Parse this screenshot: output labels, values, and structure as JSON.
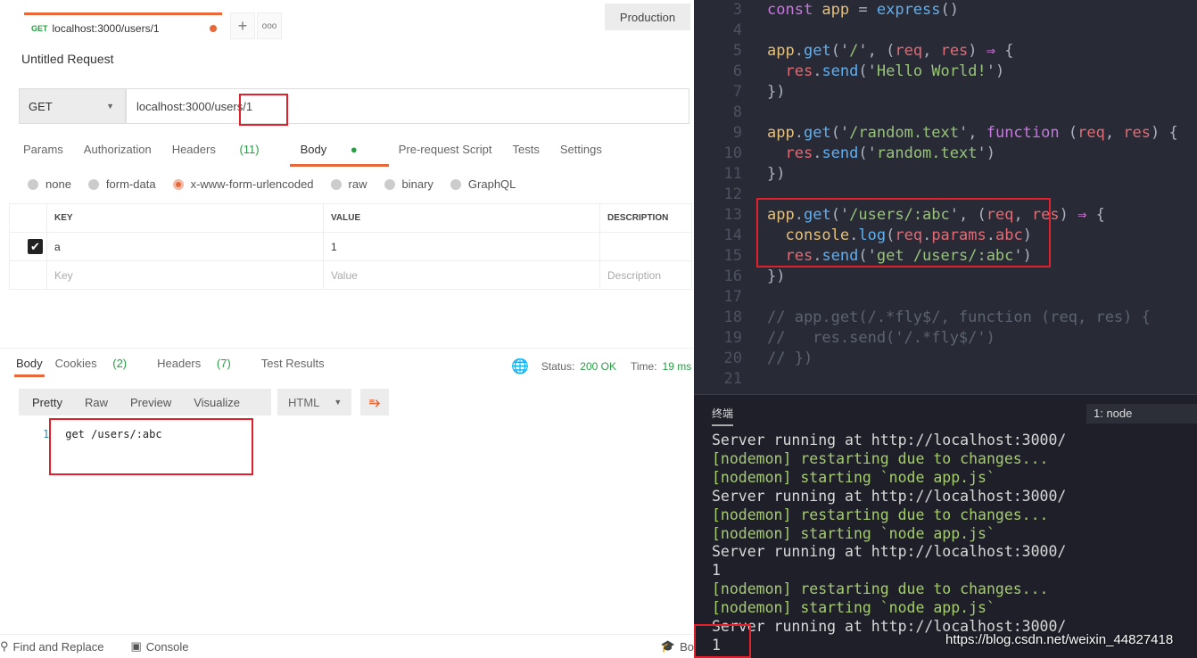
{
  "postman": {
    "tab": {
      "method": "GET",
      "url": "localhost:3000/users/1"
    },
    "environment": "Production",
    "request_title": "Untitled Request",
    "method": "GET",
    "url": "localhost:3000/users/1",
    "request_tabs": [
      {
        "label": "Params"
      },
      {
        "label": "Authorization"
      },
      {
        "label": "Headers",
        "count": "(11)"
      },
      {
        "label": "Body",
        "active": true
      },
      {
        "label": "Pre-request Script"
      },
      {
        "label": "Tests"
      },
      {
        "label": "Settings"
      }
    ],
    "body_types": [
      "none",
      "form-data",
      "x-www-form-urlencoded",
      "raw",
      "binary",
      "GraphQL"
    ],
    "body_type_selected": "x-www-form-urlencoded",
    "table": {
      "headers": [
        "KEY",
        "VALUE",
        "DESCRIPTION"
      ],
      "rows": [
        {
          "checked": true,
          "key": "a",
          "value": "1",
          "description": ""
        }
      ],
      "placeholders": {
        "key": "Key",
        "value": "Value",
        "description": "Description"
      }
    },
    "response_tabs": [
      {
        "label": "Body"
      },
      {
        "label": "Cookies",
        "count": "(2)"
      },
      {
        "label": "Headers",
        "count": "(7)"
      },
      {
        "label": "Test Results"
      }
    ],
    "status_label": "Status:",
    "status": "200 OK",
    "time_label": "Time:",
    "time": "19 ms",
    "view_modes": [
      "Pretty",
      "Raw",
      "Preview",
      "Visualize"
    ],
    "format": "HTML",
    "response_body": {
      "line": "1",
      "text": "get /users/:abc"
    },
    "footer": {
      "find": "Find and Replace",
      "console": "Console",
      "bootcamp": "Bo"
    }
  },
  "editor": {
    "lines": [
      {
        "n": "3",
        "t": [
          [
            "const ",
            "k"
          ],
          [
            "app ",
            "v"
          ],
          [
            "= ",
            "w"
          ],
          [
            "express",
            "f"
          ],
          [
            "()",
            "w"
          ]
        ]
      },
      {
        "n": "4",
        "t": []
      },
      {
        "n": "5",
        "t": [
          [
            "app",
            "v"
          ],
          [
            ".",
            "w"
          ],
          [
            "get",
            "f"
          ],
          [
            "('",
            "w"
          ],
          [
            "/",
            "s"
          ],
          [
            "', (",
            "w"
          ],
          [
            "req",
            "p"
          ],
          [
            ", ",
            "w"
          ],
          [
            "res",
            "p"
          ],
          [
            ") ",
            "w"
          ],
          [
            "⇒ ",
            "pu"
          ],
          [
            "{",
            "w"
          ]
        ]
      },
      {
        "n": "6",
        "t": [
          [
            "  res",
            "p"
          ],
          [
            ".",
            "w"
          ],
          [
            "send",
            "f"
          ],
          [
            "('",
            "w"
          ],
          [
            "Hello World!",
            "s"
          ],
          [
            "')",
            "w"
          ]
        ]
      },
      {
        "n": "7",
        "t": [
          [
            "})",
            "w"
          ]
        ]
      },
      {
        "n": "8",
        "t": []
      },
      {
        "n": "9",
        "t": [
          [
            "app",
            "v"
          ],
          [
            ".",
            "w"
          ],
          [
            "get",
            "f"
          ],
          [
            "('",
            "w"
          ],
          [
            "/random.text",
            "s"
          ],
          [
            "', ",
            "w"
          ],
          [
            "function ",
            "k"
          ],
          [
            "(",
            "w"
          ],
          [
            "req",
            "p"
          ],
          [
            ", ",
            "w"
          ],
          [
            "res",
            "p"
          ],
          [
            ") {",
            "w"
          ]
        ]
      },
      {
        "n": "10",
        "t": [
          [
            "  res",
            "p"
          ],
          [
            ".",
            "w"
          ],
          [
            "send",
            "f"
          ],
          [
            "('",
            "w"
          ],
          [
            "random.text",
            "s"
          ],
          [
            "')",
            "w"
          ]
        ]
      },
      {
        "n": "11",
        "t": [
          [
            "})",
            "w"
          ]
        ]
      },
      {
        "n": "12",
        "t": []
      },
      {
        "n": "13",
        "t": [
          [
            "app",
            "v"
          ],
          [
            ".",
            "w"
          ],
          [
            "get",
            "f"
          ],
          [
            "('",
            "w"
          ],
          [
            "/users/:abc",
            "s"
          ],
          [
            "', (",
            "w"
          ],
          [
            "req",
            "p"
          ],
          [
            ", ",
            "w"
          ],
          [
            "res",
            "p"
          ],
          [
            ") ",
            "w"
          ],
          [
            "⇒ ",
            "pu"
          ],
          [
            "{",
            "w"
          ]
        ]
      },
      {
        "n": "14",
        "t": [
          [
            "  console",
            "v"
          ],
          [
            ".",
            "w"
          ],
          [
            "log",
            "f"
          ],
          [
            "(",
            "w"
          ],
          [
            "req",
            "p"
          ],
          [
            ".",
            "w"
          ],
          [
            "params",
            "p"
          ],
          [
            ".",
            "w"
          ],
          [
            "abc",
            "p"
          ],
          [
            ")",
            "w"
          ]
        ]
      },
      {
        "n": "15",
        "t": [
          [
            "  res",
            "p"
          ],
          [
            ".",
            "w"
          ],
          [
            "send",
            "f"
          ],
          [
            "('",
            "w"
          ],
          [
            "get /users/:abc",
            "s"
          ],
          [
            "')",
            "w"
          ]
        ]
      },
      {
        "n": "16",
        "t": [
          [
            "})",
            "w"
          ]
        ]
      },
      {
        "n": "17",
        "t": []
      },
      {
        "n": "18",
        "t": [
          [
            "// app.get(/.*fly$/, function (req, res) {",
            "c"
          ]
        ]
      },
      {
        "n": "19",
        "t": [
          [
            "//   res.send('/.*fly$/')",
            "c"
          ]
        ]
      },
      {
        "n": "20",
        "t": [
          [
            "// })",
            "c"
          ]
        ]
      },
      {
        "n": "21",
        "t": []
      }
    ]
  },
  "terminal": {
    "title": "终端",
    "selector": "1: node",
    "lines": [
      {
        "text": "Server running at http://localhost:3000/",
        "type": "plain"
      },
      {
        "text": "[nodemon] restarting due to changes...",
        "type": "nodemon"
      },
      {
        "text": "[nodemon] starting `node app.js`",
        "type": "nodemon"
      },
      {
        "text": "Server running at http://localhost:3000/",
        "type": "plain"
      },
      {
        "text": "[nodemon] restarting due to changes...",
        "type": "nodemon"
      },
      {
        "text": "[nodemon] starting `node app.js`",
        "type": "nodemon"
      },
      {
        "text": "Server running at http://localhost:3000/",
        "type": "plain"
      },
      {
        "text": "1",
        "type": "plain"
      },
      {
        "text": "[nodemon] restarting due to changes...",
        "type": "nodemon"
      },
      {
        "text": "[nodemon] starting `node app.js`",
        "type": "nodemon"
      },
      {
        "text": "Server running at http://localhost:3000/",
        "type": "plain"
      },
      {
        "text": "1",
        "type": "plain"
      }
    ]
  },
  "watermark": "https://blog.csdn.net/weixin_44827418"
}
